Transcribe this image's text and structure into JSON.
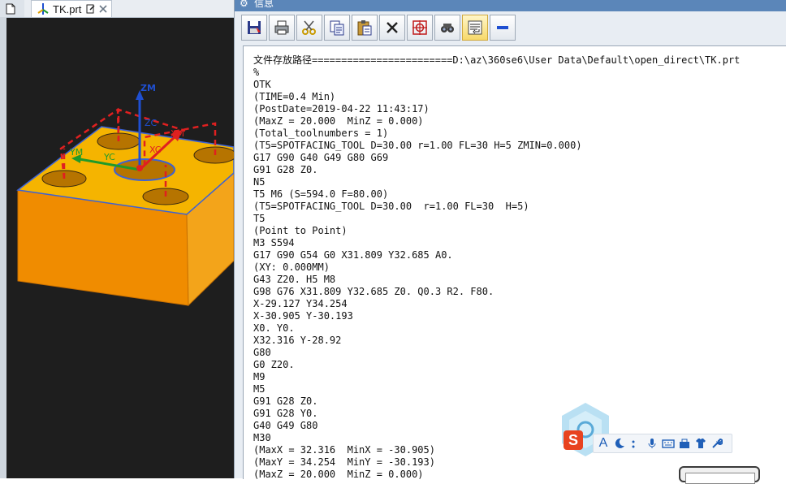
{
  "viewport": {
    "tab_file_label": "TK.prt",
    "axis_labels": {
      "zm": "ZM",
      "zc": "ZC",
      "xm": "XM",
      "xc": "XC",
      "ym": "YM",
      "yc": "YC"
    }
  },
  "info_window": {
    "title": "信息",
    "toolbar": [
      {
        "name": "save-icon"
      },
      {
        "name": "print-icon"
      },
      {
        "name": "cut-icon"
      },
      {
        "name": "copy-icon"
      },
      {
        "name": "paste-icon"
      },
      {
        "name": "delete-icon"
      },
      {
        "name": "target-icon"
      },
      {
        "name": "find-icon"
      },
      {
        "name": "wrap-text-icon"
      },
      {
        "name": "minimize-icon"
      }
    ],
    "lines": [
      "文件存放路径========================D:\\az\\360se6\\User Data\\Default\\open_direct\\TK.prt",
      "%",
      "OTK",
      "(TIME=0.4 Min)",
      "(PostDate=2019-04-22 11:43:17)",
      "(MaxZ = 20.000  MinZ = 0.000)",
      "(Total_toolnumbers = 1)",
      "(T5=SPOTFACING_TOOL D=30.00 r=1.00 FL=30 H=5 ZMIN=0.000)",
      "G17 G90 G40 G49 G80 G69",
      "G91 G28 Z0.",
      "N5",
      "T5 M6 (S=594.0 F=80.00)",
      "(T5=SPOTFACING_TOOL D=30.00  r=1.00 FL=30  H=5)",
      "T5",
      "(Point to Point)",
      "M3 S594",
      "G17 G90 G54 G0 X31.809 Y32.685 A0.",
      "(XY: 0.000MM)",
      "G43 Z20. H5 M8",
      "G98 G76 X31.809 Y32.685 Z0. Q0.3 R2. F80.",
      "X-29.127 Y34.254",
      "X-30.905 Y-30.193",
      "X0. Y0.",
      "X32.316 Y-28.92",
      "G80",
      "G0 Z20.",
      "M9",
      "M5",
      "G91 G28 Z0.",
      "G91 G28 Y0.",
      "G40 G49 G80",
      "M30",
      "(MaxX = 32.316  MinX = -30.905)",
      "(MaxY = 34.254  MinY = -30.193)",
      "(MaxZ = 20.000  MinZ = 0.000)"
    ]
  },
  "ime": {
    "logo_letter": "S",
    "mode_letter": "A"
  },
  "colors": {
    "part_top": "#f5a800",
    "part_side": "#f08c00",
    "axis_blue": "#1f4fd1",
    "axis_green": "#1f9a2a",
    "axis_red": "#e02020",
    "titlebar": "#5b86b9"
  }
}
